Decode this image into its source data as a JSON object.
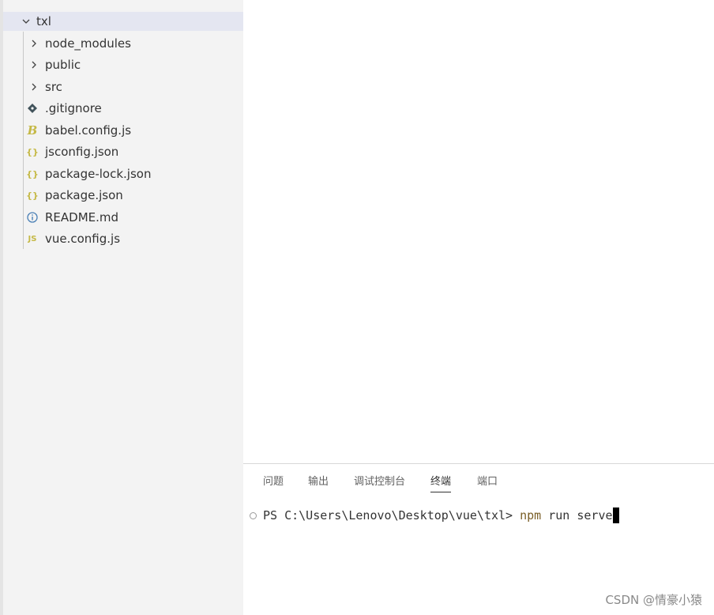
{
  "explorer": {
    "root": {
      "label": "txl"
    },
    "folders": [
      {
        "label": "node_modules"
      },
      {
        "label": "public"
      },
      {
        "label": "src"
      }
    ],
    "files": [
      {
        "label": ".gitignore",
        "icon": "git-icon",
        "color": "#41535b"
      },
      {
        "label": "babel.config.js",
        "icon": "babel-icon",
        "color": "#c5b946"
      },
      {
        "label": "jsconfig.json",
        "icon": "json-braces-icon",
        "color": "#c5b946"
      },
      {
        "label": "package-lock.json",
        "icon": "json-braces-icon",
        "color": "#c5b946"
      },
      {
        "label": "package.json",
        "icon": "json-braces-icon",
        "color": "#c5b946"
      },
      {
        "label": "README.md",
        "icon": "info-icon",
        "color": "#4a7fb5"
      },
      {
        "label": "vue.config.js",
        "icon": "js-icon",
        "color": "#c5b946"
      }
    ]
  },
  "panel": {
    "tabs": [
      {
        "label": "问题"
      },
      {
        "label": "输出"
      },
      {
        "label": "调试控制台"
      },
      {
        "label": "终端",
        "active": true
      },
      {
        "label": "端口"
      }
    ],
    "terminal": {
      "prompt": "PS C:\\Users\\Lenovo\\Desktop\\vue\\txl> ",
      "command": "npm",
      "args": " run serve"
    }
  },
  "watermark": "CSDN @情豪小猿"
}
